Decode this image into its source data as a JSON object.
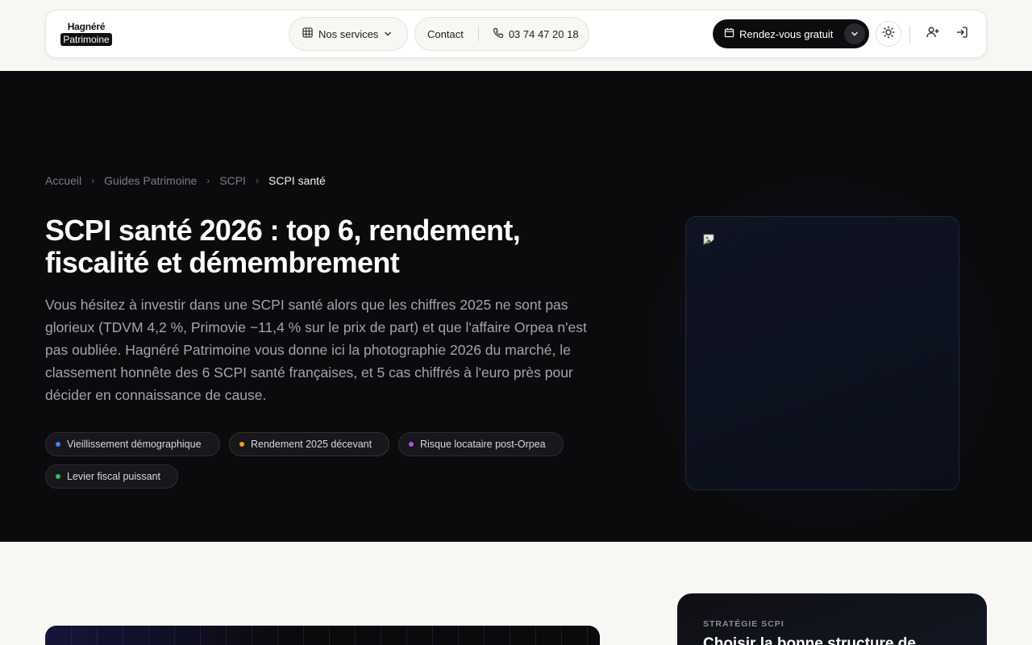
{
  "brand": {
    "line1": "Hagnéré",
    "line2": "Patrimoine"
  },
  "nav": {
    "services_label": "Nos services",
    "contact_label": "Contact",
    "phone": "03 74 47 20 18",
    "cta_label": "Rendez-vous gratuit",
    "icons": [
      "grid-icon",
      "chevron-down-icon",
      "phone-icon",
      "calendar-icon",
      "sun-icon",
      "user-plus-icon",
      "log-in-icon"
    ]
  },
  "breadcrumb": {
    "items": [
      "Accueil",
      "Guides Patrimoine",
      "SCPI"
    ],
    "current": "SCPI santé"
  },
  "hero": {
    "title": "SCPI santé 2026 : top 6, rendement, fiscalité et démembrement",
    "lede": "Vous hésitez à investir dans une SCPI santé alors que les chiffres 2025 ne sont pas glorieux (TDVM 4,2 %, Primovie −11,4 % sur le prix de part) et que l'affaire Orpea n'est pas oubliée. Hagnéré Patrimoine vous donne ici la photographie 2026 du marché, le classement honnête des 6 SCPI santé françaises, et 5 cas chiffrés à l'euro près pour décider en connaissance de cause.",
    "tags": [
      {
        "label": "Vieillissement démographique",
        "color": "#3b82f6"
      },
      {
        "label": "Rendement 2025 décevant",
        "color": "#f59e0b"
      },
      {
        "label": "Risque locataire post-Orpea",
        "color": "#a855f7"
      },
      {
        "label": "Levier fiscal puissant",
        "color": "#22c55e"
      }
    ]
  },
  "sidebar_card": {
    "kicker": "STRATÉGIE SCPI",
    "title": "Choisir la bonne structure de"
  },
  "colors": {
    "hero_bg": "#0b0b0d",
    "page_bg": "#f8f7f4",
    "cta_bg": "#0c0c0e"
  }
}
